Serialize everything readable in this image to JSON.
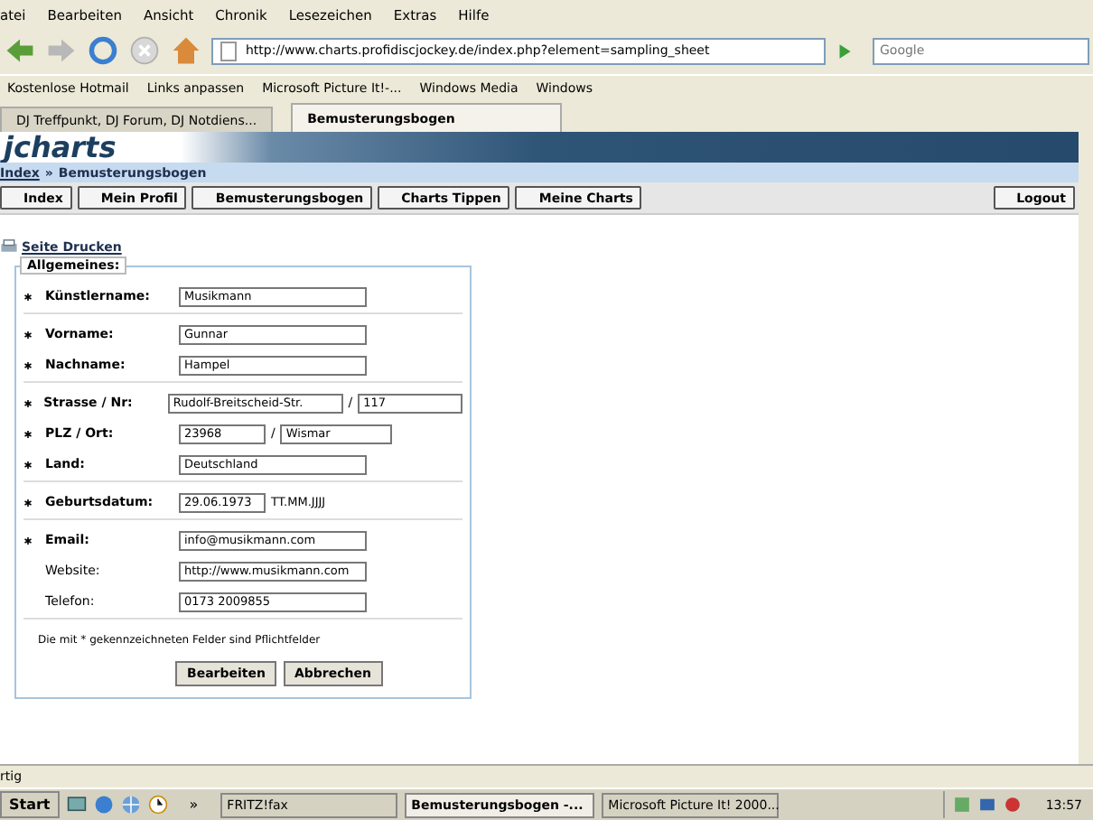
{
  "menu": [
    "atei",
    "Bearbeiten",
    "Ansicht",
    "Chronik",
    "Lesezeichen",
    "Extras",
    "Hilfe"
  ],
  "address": {
    "value": "http://www.charts.profidiscjockey.de/index.php?element=sampling_sheet"
  },
  "search": {
    "placeholder": "Google"
  },
  "bookmarks": [
    "Kostenlose Hotmail",
    "Links anpassen",
    "Microsoft Picture It!-...",
    "Windows Media",
    "Windows"
  ],
  "tabs": [
    {
      "label": "DJ Treffpunkt, DJ Forum, DJ Notdiens...",
      "selected": false
    },
    {
      "label": "Bemusterungsbogen",
      "selected": true
    }
  ],
  "site": {
    "logo": "jcharts",
    "breadcrumb": {
      "link": "Index",
      "separator": "»",
      "current": "Bemusterungsbogen"
    }
  },
  "nav": [
    {
      "label": "Index",
      "kind": "left"
    },
    {
      "label": "Mein Profil",
      "kind": "left"
    },
    {
      "label": "Bemusterungsbogen",
      "kind": "left"
    },
    {
      "label": "Charts Tippen",
      "kind": "left"
    },
    {
      "label": "Meine Charts",
      "kind": "left"
    },
    {
      "label": "Logout",
      "kind": "right"
    }
  ],
  "print_link": "Seite Drucken",
  "form": {
    "legend": "Allgemeines:",
    "sections": [
      [
        {
          "label": "Künstlername:",
          "required": true,
          "value": "Musikmann"
        }
      ],
      [
        {
          "label": "Vorname:",
          "required": true,
          "value": "Gunnar"
        },
        {
          "label": "Nachname:",
          "required": true,
          "value": "Hampel"
        }
      ],
      [
        {
          "label": "Strasse / Nr:",
          "required": true,
          "value": "Rudolf-Breitscheid-Str.",
          "separator": "/",
          "value2": "117",
          "kind": "pair"
        },
        {
          "label": "PLZ / Ort:",
          "required": true,
          "value": "23968",
          "separator": "/",
          "value2": "Wismar",
          "kind": "zip"
        },
        {
          "label": "Land:",
          "required": true,
          "value": "Deutschland"
        }
      ],
      [
        {
          "label": "Geburtsdatum:",
          "required": true,
          "value": "29.06.1973",
          "hint": "TT.MM.JJJJ",
          "kind": "date"
        }
      ],
      [
        {
          "label": "Email:",
          "required": true,
          "value": "info@musikmann.com"
        },
        {
          "label": "Website:",
          "required": false,
          "value": "http://www.musikmann.com"
        },
        {
          "label": "Telefon:",
          "required": false,
          "value": "0173 2009855"
        }
      ]
    ],
    "note": "Die mit * gekennzeichneten Felder sind Pflichtfelder",
    "buttons": [
      "Bearbeiten",
      "Abbrechen"
    ]
  },
  "status": "rtig",
  "taskbar": {
    "start": "Start",
    "more": "»",
    "tasks": [
      {
        "label": "FRITZ!fax",
        "selected": false
      },
      {
        "label": "Bemusterungsbogen -...",
        "selected": true
      },
      {
        "label": "Microsoft Picture It! 2000...",
        "selected": false
      }
    ],
    "clock": "13:57"
  }
}
